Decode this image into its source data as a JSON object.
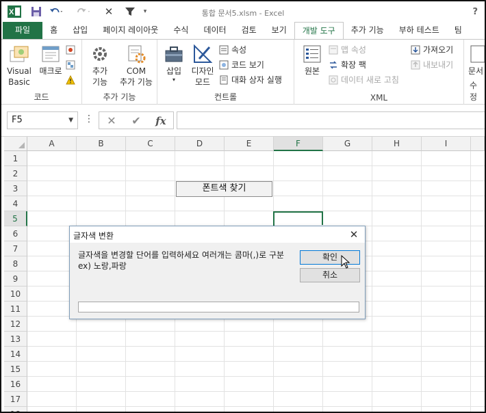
{
  "window": {
    "title": "통합 문서5.xlsm - Excel",
    "help": "?"
  },
  "tabs": [
    {
      "label": "파일"
    },
    {
      "label": "홈"
    },
    {
      "label": "삽입"
    },
    {
      "label": "페이지 레이아웃"
    },
    {
      "label": "수식"
    },
    {
      "label": "데이터"
    },
    {
      "label": "검토"
    },
    {
      "label": "보기"
    },
    {
      "label": "개발 도구"
    },
    {
      "label": "추가 기능"
    },
    {
      "label": "부하 테스트"
    },
    {
      "label": "팀"
    }
  ],
  "ribbon": {
    "code": {
      "label": "코드",
      "visual_basic_line1": "Visual",
      "visual_basic_line2": "Basic",
      "macro": "매크로"
    },
    "addins": {
      "label": "추가 기능",
      "addins_line1": "추가",
      "addins_line2": "기능",
      "com_line1": "COM",
      "com_line2": "추가 기능"
    },
    "controls": {
      "label": "컨트롤",
      "insert": "삽입",
      "design_line1": "디자인",
      "design_line2": "모드",
      "properties": "속성",
      "view_code": "코드 보기",
      "run_dialog": "대화 상자 실행"
    },
    "xml": {
      "label": "XML",
      "source": "원본",
      "map_properties": "맵 속성",
      "expansion_packs": "확장 팩",
      "refresh_data": "데이터 새로 고침",
      "import": "가져오기",
      "export": "내보내기"
    },
    "modify": {
      "document_label": "문서",
      "label_partial": "수정"
    }
  },
  "formula_bar": {
    "name_box": "F5",
    "fx": "fx",
    "value": ""
  },
  "sheet": {
    "columns": [
      "A",
      "B",
      "C",
      "D",
      "E",
      "F",
      "G",
      "H",
      "I"
    ],
    "selected_column": "F",
    "rows": [
      "1",
      "2",
      "3",
      "4",
      "5",
      "6",
      "7",
      "8",
      "9",
      "10",
      "11",
      "12",
      "13",
      "14",
      "15",
      "16",
      "17",
      "18"
    ],
    "selected_row": "5",
    "cell_d3": "폰트색 찾기"
  },
  "dialog": {
    "title": "글자색 변환",
    "prompt": "글자색을 변경할 단어를 입력하세요 여러개는 콤마(,)로 구분 ex) 노랑,파랑",
    "ok": "확인",
    "cancel": "취소",
    "input_value": ""
  },
  "colors": {
    "excel_green": "#217346",
    "ribbon_bg": "#ffffff",
    "header_bg": "#f2f2f2"
  }
}
